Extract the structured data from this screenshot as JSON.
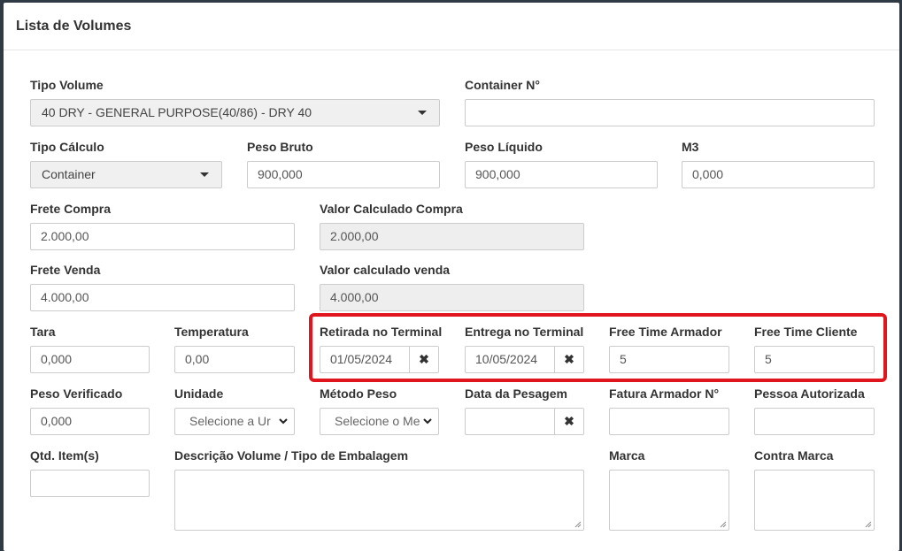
{
  "modal": {
    "title": "Lista de Volumes"
  },
  "fields": {
    "tipo_volume": {
      "label": "Tipo Volume",
      "value": "40 DRY - GENERAL PURPOSE(40/86) - DRY 40"
    },
    "container_no": {
      "label": "Container N°",
      "value": ""
    },
    "tipo_calculo": {
      "label": "Tipo Cálculo",
      "value": "Container"
    },
    "peso_bruto": {
      "label": "Peso Bruto",
      "value": "900,000"
    },
    "peso_liquido": {
      "label": "Peso Líquido",
      "value": "900,000"
    },
    "m3": {
      "label": "M3",
      "value": "0,000"
    },
    "frete_compra": {
      "label": "Frete Compra",
      "value": "2.000,00"
    },
    "valor_calculado_compra": {
      "label": "Valor Calculado Compra",
      "value": "2.000,00"
    },
    "frete_venda": {
      "label": "Frete Venda",
      "value": "4.000,00"
    },
    "valor_calculado_venda": {
      "label": "Valor calculado venda",
      "value": "4.000,00"
    },
    "tara": {
      "label": "Tara",
      "value": "0,000"
    },
    "temperatura": {
      "label": "Temperatura",
      "value": "0,00"
    },
    "retirada_terminal": {
      "label": "Retirada no Terminal",
      "value": "01/05/2024"
    },
    "entrega_terminal": {
      "label": "Entrega no Terminal",
      "value": "10/05/2024"
    },
    "free_time_armador": {
      "label": "Free Time Armador",
      "value": "5"
    },
    "free_time_cliente": {
      "label": "Free Time Cliente",
      "value": "5"
    },
    "peso_verificado": {
      "label": "Peso Verificado",
      "value": "0,000"
    },
    "unidade": {
      "label": "Unidade",
      "value": "Selecione a Ur"
    },
    "metodo_peso": {
      "label": "Método Peso",
      "value": "Selecione o Me"
    },
    "data_pesagem": {
      "label": "Data da Pesagem",
      "value": ""
    },
    "fatura_armador": {
      "label": "Fatura Armador N°",
      "value": ""
    },
    "pessoa_autorizada": {
      "label": "Pessoa Autorizada",
      "value": ""
    },
    "qtd_item": {
      "label": "Qtd. Item(s)",
      "value": ""
    },
    "descricao_volume": {
      "label": "Descrição Volume / Tipo de Embalagem",
      "value": ""
    },
    "marca": {
      "label": "Marca",
      "value": ""
    },
    "contra_marca": {
      "label": "Contra Marca",
      "value": ""
    }
  },
  "icons": {
    "clear": "✖",
    "dropdown": "caret-down-icon",
    "native_select": "chevron-down-icon",
    "resize": "resize-grip-icon"
  },
  "colors": {
    "highlight": "#e0151d",
    "readonly_bg": "#eeeeee"
  }
}
